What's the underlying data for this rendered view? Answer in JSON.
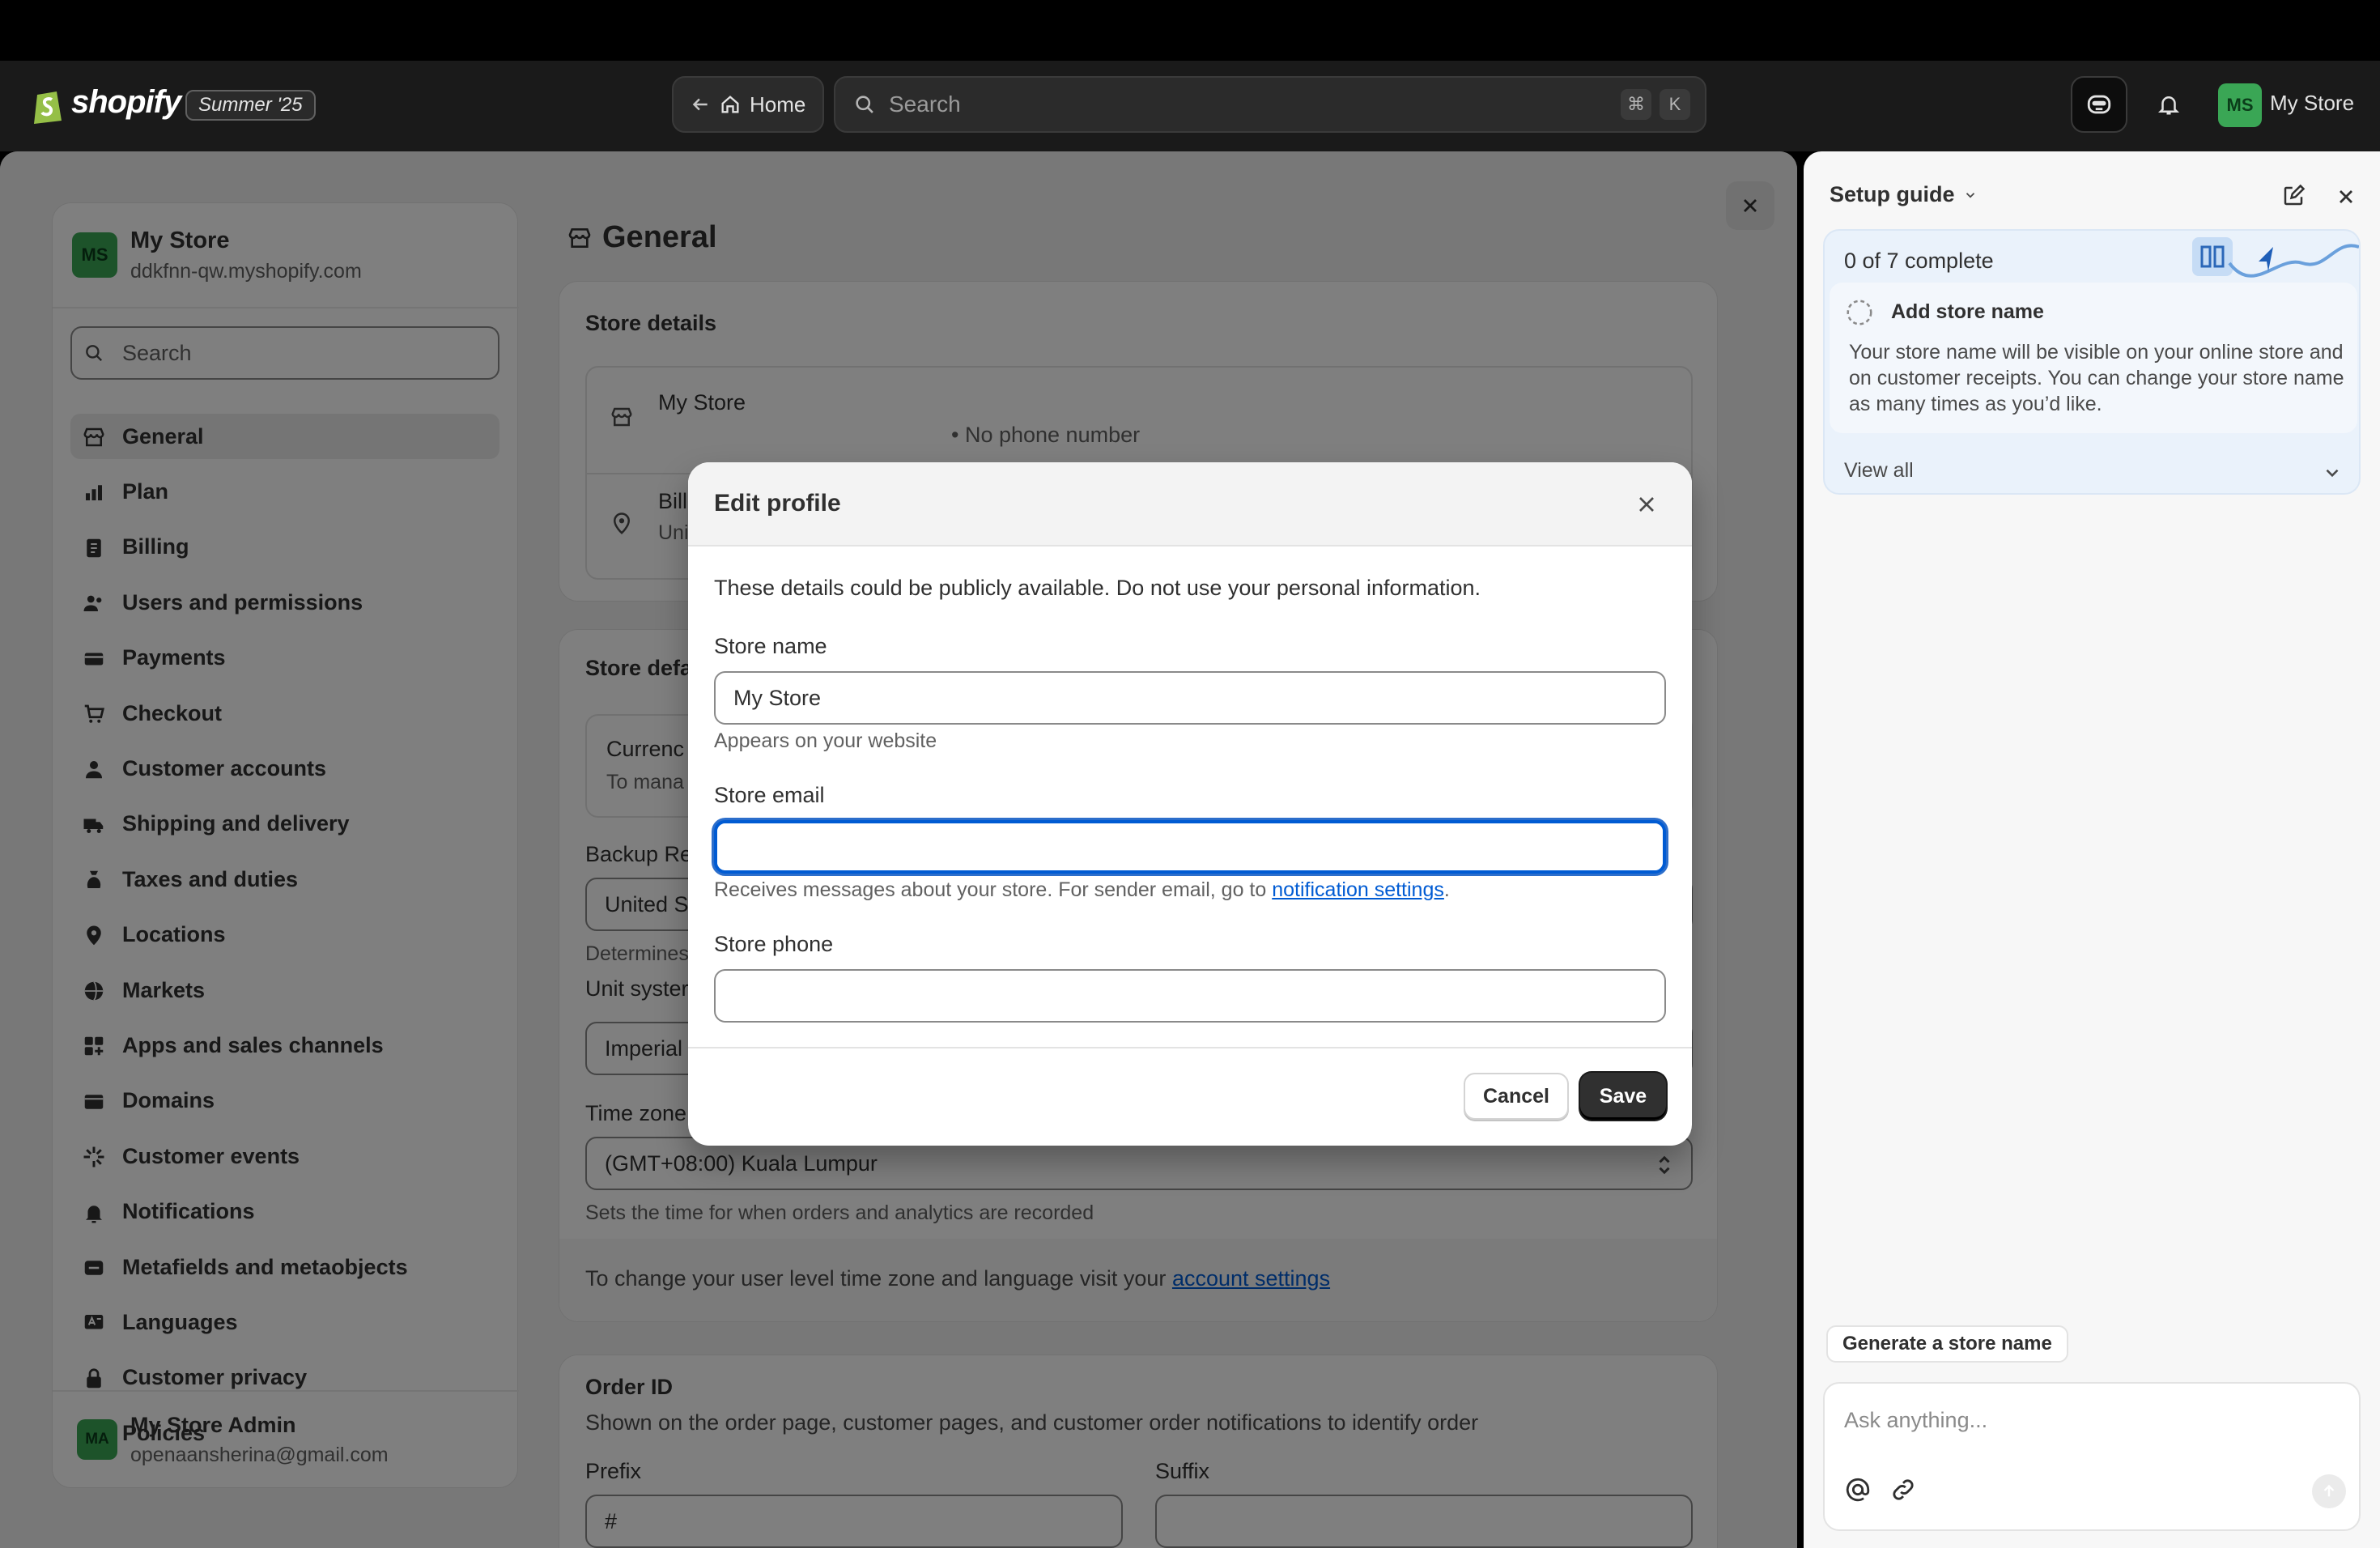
{
  "topbar": {
    "brand": "shopify",
    "edition": "Summer '25",
    "home_label": "Home",
    "search_placeholder": "Search",
    "shortcut_cmd": "⌘",
    "shortcut_key": "K",
    "avatar_initials": "MS",
    "store_name": "My Store"
  },
  "sidebar": {
    "avatar_initials": "MS",
    "store_name": "My Store",
    "domain": "ddkfnn-qw.myshopify.com",
    "search_placeholder": "Search",
    "items": [
      {
        "label": "General",
        "icon": "store-icon",
        "active": true
      },
      {
        "label": "Plan",
        "icon": "plan-icon"
      },
      {
        "label": "Billing",
        "icon": "billing-icon"
      },
      {
        "label": "Users and permissions",
        "icon": "users-icon"
      },
      {
        "label": "Payments",
        "icon": "payments-icon"
      },
      {
        "label": "Checkout",
        "icon": "cart-icon"
      },
      {
        "label": "Customer accounts",
        "icon": "person-icon"
      },
      {
        "label": "Shipping and delivery",
        "icon": "truck-icon"
      },
      {
        "label": "Taxes and duties",
        "icon": "tax-icon"
      },
      {
        "label": "Locations",
        "icon": "location-icon"
      },
      {
        "label": "Markets",
        "icon": "globe-icon"
      },
      {
        "label": "Apps and sales channels",
        "icon": "apps-icon"
      },
      {
        "label": "Domains",
        "icon": "domain-icon"
      },
      {
        "label": "Customer events",
        "icon": "events-icon"
      },
      {
        "label": "Notifications",
        "icon": "bell-icon"
      },
      {
        "label": "Metafields and metaobjects",
        "icon": "metafields-icon"
      },
      {
        "label": "Languages",
        "icon": "language-icon"
      },
      {
        "label": "Customer privacy",
        "icon": "lock-icon"
      },
      {
        "label": "Policies",
        "icon": "policies-icon"
      }
    ],
    "admin": {
      "initials": "MA",
      "name": "My Store Admin",
      "email": "openaansherina@gmail.com"
    }
  },
  "page": {
    "title": "General",
    "store_details": {
      "heading": "Store details",
      "store_name": "My Store",
      "phone": "• No phone number",
      "billing_label_partial": "Bill",
      "billing_value_partial": "Uni"
    },
    "store_defaults": {
      "heading_partial": "Store defa",
      "currency_label_partial": "Currenc",
      "currency_desc_partial": "To mana",
      "backup_label_partial": "Backup Re",
      "backup_value_partial": "United S",
      "backup_help_partial": "Determines",
      "unit_label_partial": "Unit syster",
      "unit_value_partial": "Imperial",
      "timezone_label_partial": "Time zone",
      "timezone_value": "(GMT+08:00) Kuala Lumpur",
      "timezone_help": "Sets the time for when orders and analytics are recorded",
      "account_note": "To change your user level time zone and language visit your",
      "account_link": "account settings"
    },
    "order_id": {
      "heading": "Order ID",
      "description": "Shown on the order page, customer pages, and customer order notifications to identify order",
      "prefix_label": "Prefix",
      "prefix_value": "#",
      "suffix_label": "Suffix",
      "suffix_value": ""
    }
  },
  "modal": {
    "title": "Edit profile",
    "notice": "These details could be publicly available. Do not use your personal information.",
    "store_name_label": "Store name",
    "store_name_value": "My Store",
    "store_name_help": "Appears on your website",
    "store_email_label": "Store email",
    "store_email_value": "",
    "store_email_help": "Receives messages about your store. For sender email, go to",
    "store_email_help_link": "notification settings",
    "store_email_help_end": ".",
    "store_phone_label": "Store phone",
    "store_phone_value": "",
    "cancel_label": "Cancel",
    "save_label": "Save"
  },
  "setup_guide": {
    "title": "Setup guide",
    "progress": "0 of 7 complete",
    "item_title": "Add store name",
    "item_desc": "Your store name will be visible on your online store and on customer receipts. You can change your store name as many times as you’d like.",
    "view_all": "View all",
    "suggestion": "Generate a store name",
    "ask_placeholder": "Ask anything..."
  },
  "colors": {
    "accent_blue": "#005bd3",
    "avatar_green": "#3aa655",
    "topbar": "#1a1a1a",
    "save_button": "#303030"
  }
}
